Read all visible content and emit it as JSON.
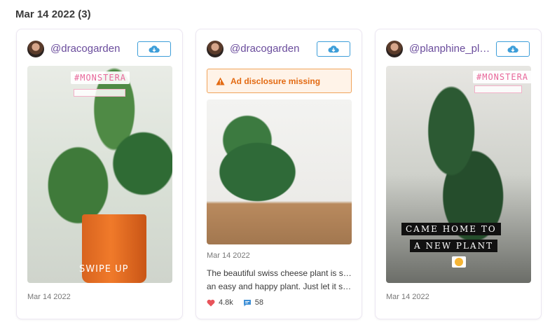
{
  "group": {
    "date_heading": "Mar 14 2022 (3)"
  },
  "colors": {
    "handle": "#6a4c9c",
    "download_border": "#3d9ed9",
    "warning": "#e36a12",
    "like": "#e8545b",
    "comment": "#3d8fd6"
  },
  "cards": [
    {
      "handle": "@dracogarden",
      "media_type": "story",
      "sticker_tag": "#MONSTERA",
      "overlay_text": "SWIPE UP",
      "date": "Mar 14 2022"
    },
    {
      "handle": "@dracogarden",
      "media_type": "post",
      "warning": "Ad disclosure missing",
      "date": "Mar 14 2022",
      "caption_line1": "The beautiful swiss cheese plant is such",
      "caption_line2": "an easy and happy plant. Just let it sun…",
      "likes": "4.8k",
      "comments": "58"
    },
    {
      "handle": "@planphine_pl…",
      "media_type": "story",
      "sticker_tag": "#MONSTERA",
      "overlay_line1": "CAME HOME TO",
      "overlay_line2": "A NEW PLANT",
      "date": "Mar 14 2022"
    }
  ],
  "icons": {
    "download": "cloud-download-icon",
    "warning": "warning-triangle-icon",
    "like": "heart-icon",
    "comment": "comment-icon"
  }
}
